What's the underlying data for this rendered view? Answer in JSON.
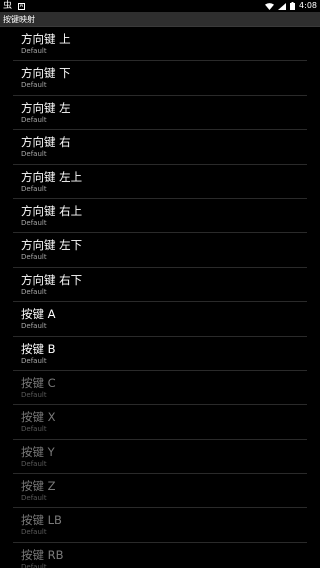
{
  "status_bar": {
    "app_glyph": "虫",
    "notif_letter": "A",
    "time": "4:08"
  },
  "title_bar": {
    "title": "按键映射"
  },
  "items": [
    {
      "label": "方向键 上",
      "sub": "Default",
      "enabled": true
    },
    {
      "label": "方向键 下",
      "sub": "Default",
      "enabled": true
    },
    {
      "label": "方向键 左",
      "sub": "Default",
      "enabled": true
    },
    {
      "label": "方向键 右",
      "sub": "Default",
      "enabled": true
    },
    {
      "label": "方向键 左上",
      "sub": "Default",
      "enabled": true
    },
    {
      "label": "方向键 右上",
      "sub": "Default",
      "enabled": true
    },
    {
      "label": "方向键 左下",
      "sub": "Default",
      "enabled": true
    },
    {
      "label": "方向键 右下",
      "sub": "Default",
      "enabled": true
    },
    {
      "label": "按键 A",
      "sub": "Default",
      "enabled": true
    },
    {
      "label": "按键 B",
      "sub": "Default",
      "enabled": true
    },
    {
      "label": "按键 C",
      "sub": "Default",
      "enabled": false
    },
    {
      "label": "按键 X",
      "sub": "Default",
      "enabled": false
    },
    {
      "label": "按键 Y",
      "sub": "Default",
      "enabled": false
    },
    {
      "label": "按键 Z",
      "sub": "Default",
      "enabled": false
    },
    {
      "label": "按键 LB",
      "sub": "Default",
      "enabled": false
    },
    {
      "label": "按键 RB",
      "sub": "Default",
      "enabled": false
    }
  ],
  "icons": {
    "wifi": "wifi-icon",
    "signal": "cell-signal-icon",
    "battery": "battery-icon"
  }
}
